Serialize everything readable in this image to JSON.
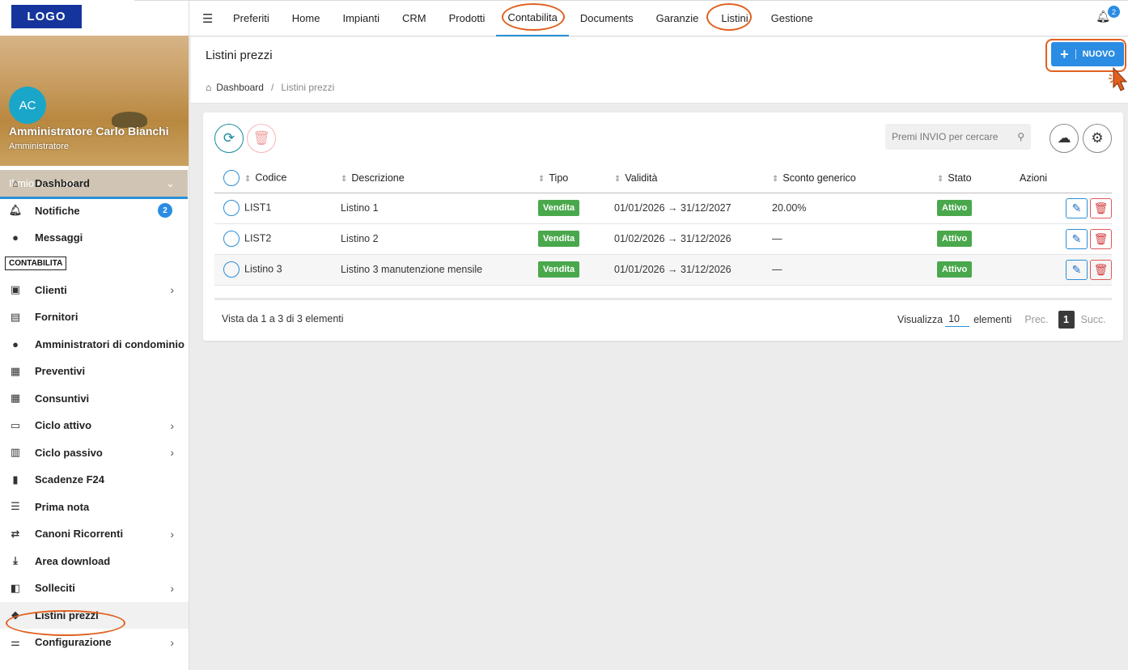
{
  "brand": {
    "logo_text": "LOGO",
    "accent": "#2b8ce3",
    "highlight_oval": "#e0611f"
  },
  "sidebar": {
    "avatar_initials": "AC",
    "user_name": "Amministratore Carlo Bianchi",
    "user_role": "Amministratore",
    "account_label": "Il mio Account",
    "items_top": [
      {
        "label": "Dashboard",
        "icon": "home-icon"
      },
      {
        "label": "Notifiche",
        "icon": "bell-icon",
        "badge": "2"
      },
      {
        "label": "Messaggi",
        "icon": "chat-icon"
      }
    ],
    "section_label": "CONTABILITA",
    "items": [
      {
        "label": "Clienti",
        "icon": "briefcase-icon"
      },
      {
        "label": "Fornitori",
        "icon": "id-card-icon"
      },
      {
        "label": "Amministratori di condominio",
        "icon": "user-icon"
      },
      {
        "label": "Preventivi",
        "icon": "document-icon"
      },
      {
        "label": "Consuntivi",
        "icon": "document-icon"
      },
      {
        "label": "Ciclo attivo",
        "icon": "money-icon"
      },
      {
        "label": "Ciclo passivo",
        "icon": "cash-register-icon"
      },
      {
        "label": "Scadenze F24",
        "icon": "file-icon"
      },
      {
        "label": "Prima nota",
        "icon": "list-icon"
      },
      {
        "label": "Canoni Ricorrenti",
        "icon": "repeat-icon"
      },
      {
        "label": "Area download",
        "icon": "download-icon"
      },
      {
        "label": "Solleciti",
        "icon": "megaphone-icon"
      },
      {
        "label": "Listini prezzi",
        "icon": "tag-icon"
      },
      {
        "label": "Configurazione",
        "icon": "sliders-icon"
      }
    ]
  },
  "topbar": {
    "menu": [
      "Preferiti",
      "Home",
      "Impianti",
      "CRM",
      "Prodotti",
      "Contabilita",
      "Documents",
      "Garanzie",
      "Listini",
      "Gestione"
    ],
    "notification_count": "2"
  },
  "page": {
    "title": "Listini prezzi",
    "breadcrumb_home": "Dashboard",
    "breadcrumb_current": "Listini prezzi",
    "new_button": "NUOVO"
  },
  "toolbar": {
    "search_placeholder": "Premi INVIO per cercare"
  },
  "table": {
    "headers": [
      "Codice",
      "Descrizione",
      "Tipo",
      "Validità",
      "Sconto generico",
      "Stato",
      "Azioni"
    ],
    "rows": [
      {
        "codice": "LIST1",
        "descrizione": "Listino 1",
        "tipo": "Vendita",
        "validita": "01/01/2026 → 31/12/2027",
        "sconto": "20.00%",
        "stato": "Attivo"
      },
      {
        "codice": "LIST2",
        "descrizione": "Listino 2",
        "tipo": "Vendita",
        "validita": "01/02/2026 → 31/12/2026",
        "sconto": "—",
        "stato": "Attivo"
      },
      {
        "codice": "Listino 3",
        "descrizione": "Listino 3 manutenzione mensile",
        "tipo": "Vendita",
        "validita": "01/01/2026 → 31/12/2026",
        "sconto": "—",
        "stato": "Attivo"
      }
    ]
  },
  "footer": {
    "info": "Vista da 1 a 3 di 3 elementi",
    "show_label": "Visualizza",
    "page_size": "10",
    "elements_label": "elementi",
    "prev": "Prec.",
    "current_page": "1",
    "next": "Succ."
  }
}
